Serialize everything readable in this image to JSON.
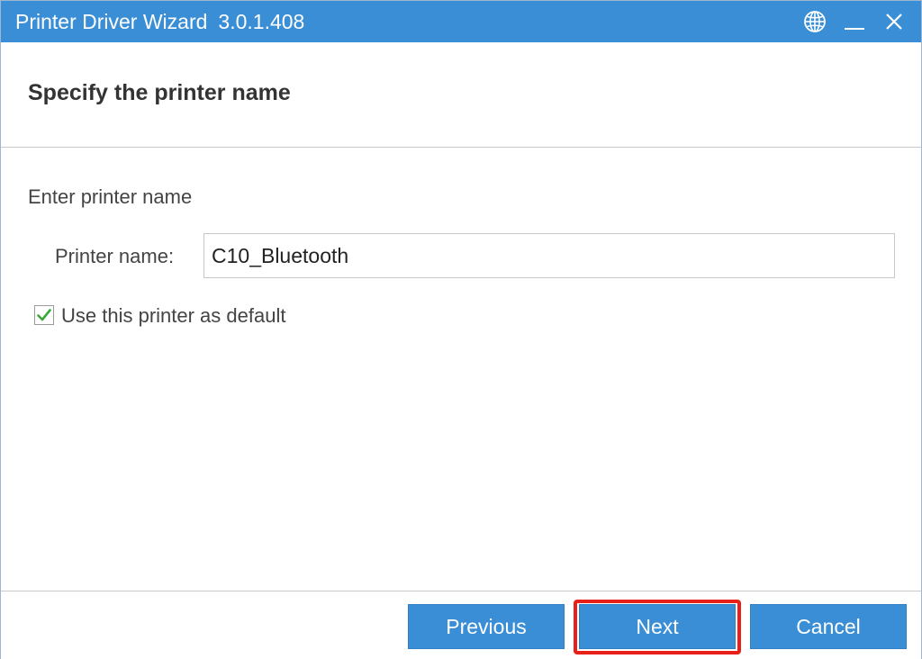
{
  "window": {
    "title": "Printer Driver Wizard",
    "version": "3.0.1.408",
    "controls": {
      "language_icon": "globe-icon",
      "minimize_icon": "minimize-icon",
      "close_icon": "close-icon"
    }
  },
  "header": {
    "title": "Specify the printer name"
  },
  "form": {
    "section_label": "Enter printer name",
    "printer_name_label": "Printer name:",
    "printer_name_value": "C10_Bluetooth",
    "default_checkbox_label": "Use this printer as default",
    "default_checkbox_checked": true
  },
  "footer": {
    "previous_label": "Previous",
    "next_label": "Next",
    "cancel_label": "Cancel",
    "highlighted_button": "next"
  },
  "colors": {
    "accent": "#3a8ed6",
    "highlight": "#e8201a",
    "check": "#3aa83a"
  }
}
